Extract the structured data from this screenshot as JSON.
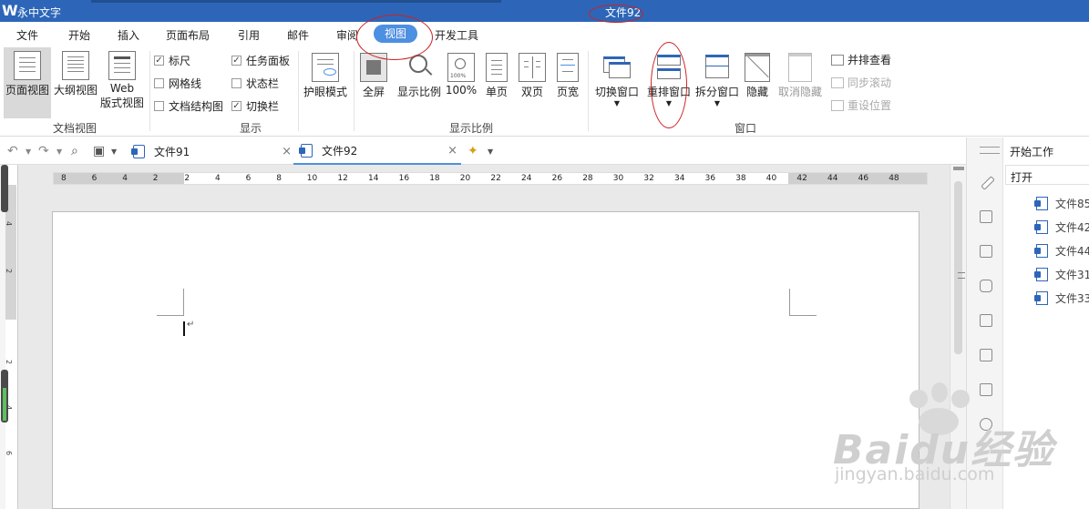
{
  "titlebar": {
    "app_name": "永中文字",
    "doc_title": "文件92"
  },
  "menu": {
    "items": [
      {
        "label": "文件"
      },
      {
        "label": "开始"
      },
      {
        "label": "插入"
      },
      {
        "label": "页面布局"
      },
      {
        "label": "引用"
      },
      {
        "label": "邮件"
      },
      {
        "label": "审阅"
      },
      {
        "label": "视图",
        "active": true
      },
      {
        "label": "开发工具"
      }
    ]
  },
  "ribbon": {
    "doc_view": {
      "group": "文档视图",
      "page_view": "页面视图",
      "outline_view": "大纲视图",
      "web_view_1": "Web",
      "web_view_2": "版式视图"
    },
    "show": {
      "group": "显示",
      "ruler": "标尺",
      "gridlines": "网格线",
      "doc_structure": "文档结构图",
      "task_pane": "任务面板",
      "status_bar": "状态栏",
      "switch_bar": "切换栏"
    },
    "eye_mode": "护眼模式",
    "zoom": {
      "group": "显示比例",
      "fullscreen": "全屏",
      "zoom_ratio": "显示比例",
      "hundred": "100%",
      "single_page": "单页",
      "double_page": "双页",
      "page_width": "页宽"
    },
    "window": {
      "group": "窗口",
      "switch_window": "切换窗口",
      "arrange_window": "重排窗口",
      "split_window": "拆分窗口",
      "hide": "隐藏",
      "unhide": "取消隐藏",
      "side_by_side": "并排查看",
      "sync_scroll": "同步滚动",
      "reset_position": "重设位置"
    }
  },
  "tabs": [
    {
      "label": "文件91"
    },
    {
      "label": "文件92",
      "active": true
    }
  ],
  "hruler": {
    "numbers": [
      "8",
      "6",
      "4",
      "2",
      "2",
      "4",
      "6",
      "8",
      "10",
      "12",
      "14",
      "16",
      "18",
      "20",
      "22",
      "24",
      "26",
      "28",
      "30",
      "32",
      "34",
      "36",
      "38",
      "40",
      "42",
      "44",
      "46",
      "48"
    ]
  },
  "vruler": {
    "numbers": [
      "4",
      "2",
      "2",
      "4",
      "6"
    ]
  },
  "document": {
    "paragraph_mark": "↵"
  },
  "right_panel": {
    "title": "开始工作",
    "open": "打开",
    "recent_files": [
      "文件85",
      "文件42",
      "文件44",
      "文件31",
      "文件33"
    ]
  },
  "watermark": {
    "brand": "Baidu经验",
    "url": "jingyan.baidu.com"
  },
  "colors": {
    "title_bar": "#2d66b8",
    "active_tab": "#4d8fe0",
    "annotation": "#cc2222"
  }
}
